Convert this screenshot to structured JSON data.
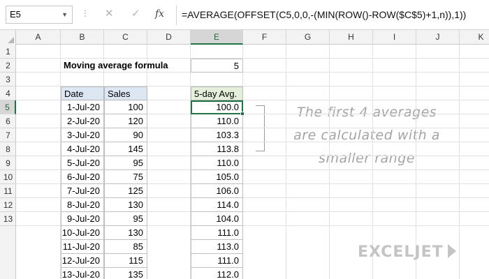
{
  "formula_bar": {
    "cell_reference": "E5",
    "formula": "=AVERAGE(OFFSET(C5,0,0,-(MIN(ROW()-ROW($C$5)+1,n)),1))",
    "cancel_glyph": "✕",
    "enter_glyph": "✓",
    "fx_label": "fx"
  },
  "columns": [
    "A",
    "B",
    "C",
    "D",
    "E",
    "F",
    "G",
    "H",
    "I",
    "J",
    "K"
  ],
  "active_column": "E",
  "rows": [
    "1",
    "2",
    "3",
    "4",
    "5",
    "6",
    "7",
    "8",
    "9",
    "10",
    "11",
    "12",
    "13"
  ],
  "active_row": "5",
  "input": {
    "label": "Moving average formula",
    "value": "5"
  },
  "table": {
    "headers": {
      "date": "Date",
      "sales": "Sales",
      "avg": "5-day Avg."
    },
    "rows": [
      {
        "date": "1-Jul-20",
        "sales": "100",
        "avg": "100.0"
      },
      {
        "date": "2-Jul-20",
        "sales": "120",
        "avg": "110.0"
      },
      {
        "date": "3-Jul-20",
        "sales": "90",
        "avg": "103.3"
      },
      {
        "date": "4-Jul-20",
        "sales": "145",
        "avg": "113.8"
      },
      {
        "date": "5-Jul-20",
        "sales": "95",
        "avg": "110.0"
      },
      {
        "date": "6-Jul-20",
        "sales": "75",
        "avg": "105.0"
      },
      {
        "date": "7-Jul-20",
        "sales": "125",
        "avg": "106.0"
      },
      {
        "date": "8-Jul-20",
        "sales": "130",
        "avg": "114.0"
      },
      {
        "date": "9-Jul-20",
        "sales": "95",
        "avg": "104.0"
      },
      {
        "date": "10-Jul-20",
        "sales": "130",
        "avg": "111.0"
      },
      {
        "date": "11-Jul-20",
        "sales": "85",
        "avg": "113.0"
      },
      {
        "date": "12-Jul-20",
        "sales": "115",
        "avg": "111.0"
      },
      {
        "date": "13-Jul-20",
        "sales": "135",
        "avg": "112.0"
      }
    ]
  },
  "annotation": {
    "lines": [
      "The first 4 averages",
      "are calculated with a",
      "smaller range"
    ]
  },
  "watermark": {
    "text": "EXCELJET"
  },
  "colors": {
    "selection": "#217346",
    "date_sales_header": "#dde6f3",
    "avg_header": "#e3efd9",
    "annotation_text": "#a3a3a3"
  }
}
